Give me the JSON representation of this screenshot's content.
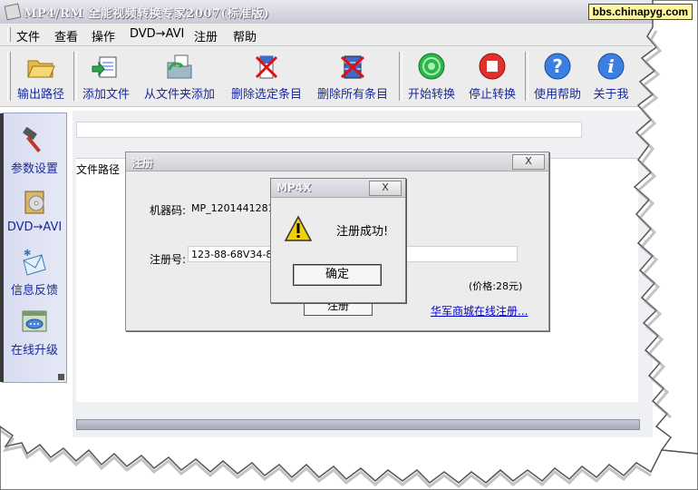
{
  "window": {
    "title": "MP4/RM 全能视频转换专家2007(标准版)",
    "watermark": "bbs.chinapyg.com"
  },
  "menu": [
    {
      "label": "文件"
    },
    {
      "label": "查看"
    },
    {
      "label": "操作"
    },
    {
      "label": "DVD→AVI"
    },
    {
      "label": "注册"
    },
    {
      "label": "帮助"
    }
  ],
  "toolbar": [
    {
      "label": "输出路径",
      "icon": "folder-open-icon"
    },
    {
      "label": "添加文件",
      "icon": "add-file-icon"
    },
    {
      "label": "从文件夹添加",
      "icon": "add-from-folder-icon"
    },
    {
      "label": "删除选定条目",
      "icon": "delete-selected-icon"
    },
    {
      "label": "删除所有条目",
      "icon": "delete-all-icon"
    },
    {
      "label": "开始转换",
      "icon": "start-convert-icon"
    },
    {
      "label": "停止转换",
      "icon": "stop-convert-icon"
    },
    {
      "label": "使用帮助",
      "icon": "help-icon"
    },
    {
      "label": "关于我",
      "icon": "about-icon"
    }
  ],
  "sidebar": [
    {
      "label": "参数设置",
      "icon": "hammer-icon"
    },
    {
      "label": "DVD→AVI",
      "icon": "dvd-icon"
    },
    {
      "label": "信息反馈",
      "icon": "envelope-icon"
    },
    {
      "label": "在线升级",
      "icon": "chat-window-icon"
    }
  ],
  "main": {
    "file_list_header": "文件路径"
  },
  "register_dialog": {
    "title": "注册",
    "close_label": "X",
    "machine_code_label": "机器码:",
    "machine_code_value": "MP_12014412812",
    "reg_code_label": "注册号:",
    "reg_code_value": "123-88-68V34-89-",
    "price": "(价格:28元)",
    "register_button": "注册",
    "online_link": "华军商城在线注册..."
  },
  "message_box": {
    "title": "MP4X",
    "close_label": "X",
    "message": "注册成功!",
    "ok_button": "确定",
    "icon": "warning-icon"
  },
  "colors": {
    "toolbar_label": "#1a2b9a",
    "link": "#0000cc",
    "watermark_bg": "#fff7a0"
  }
}
